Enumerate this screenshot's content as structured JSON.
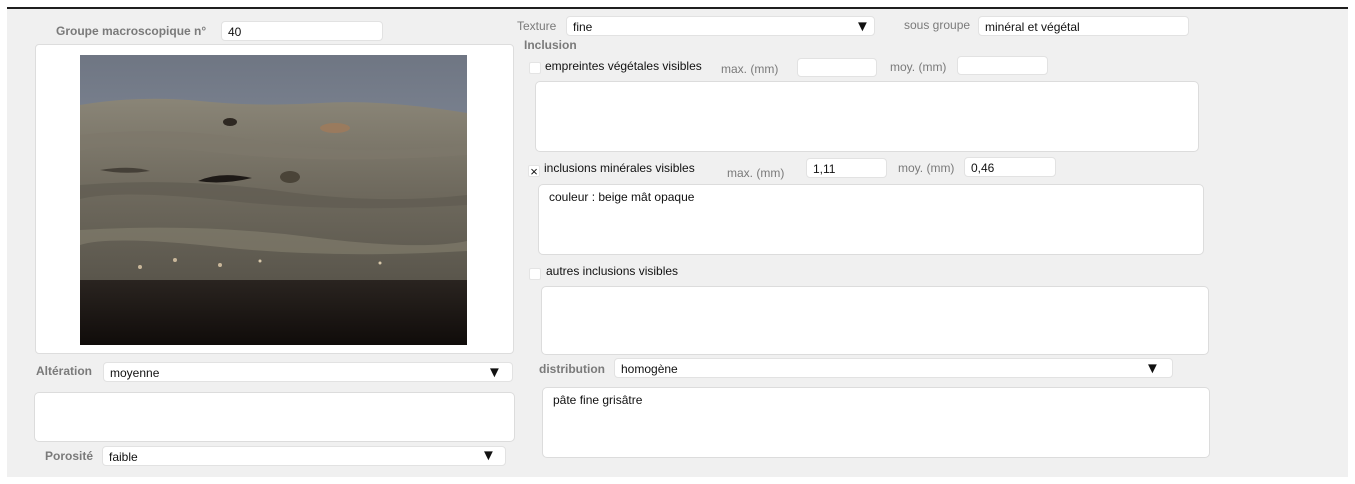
{
  "groupe": {
    "label": "Groupe macroscopique n°",
    "value": "40"
  },
  "texture": {
    "label": "Texture",
    "value": "fine"
  },
  "sous_groupe": {
    "label": "sous groupe",
    "value": "minéral et végétal"
  },
  "inclusion": {
    "heading": "Inclusion",
    "vegetal": {
      "label": "empreintes végétales visibles",
      "checked": false,
      "max_label": "max. (mm)",
      "max_value": "",
      "moy_label": "moy. (mm)",
      "moy_value": "",
      "notes": ""
    },
    "mineral": {
      "label": "inclusions minérales visibles",
      "checked": true,
      "check_mark": "×",
      "max_label": "max. (mm)",
      "max_value": "1,11",
      "moy_label": "moy. (mm)",
      "moy_value": "0,46",
      "notes": "couleur : beige mât opaque"
    },
    "autres": {
      "label": "autres inclusions visibles",
      "checked": false,
      "notes": ""
    }
  },
  "distribution": {
    "label": "distribution",
    "value": "homogène",
    "notes": "pâte fine grisâtre"
  },
  "alteration": {
    "label": "Altération",
    "value": "moyenne",
    "notes": ""
  },
  "porosite": {
    "label": "Porosité",
    "value": "faible"
  },
  "dropdown_arrow": "▼",
  "colors": {
    "frame_bg": "#f0f0f0",
    "field_bg": "#ffffff",
    "label": "#7a7a7a",
    "top_border": "#1e1e1e"
  },
  "icons": {
    "dropdown": "triangle-down-icon",
    "checkbox": "checkbox-icon"
  }
}
